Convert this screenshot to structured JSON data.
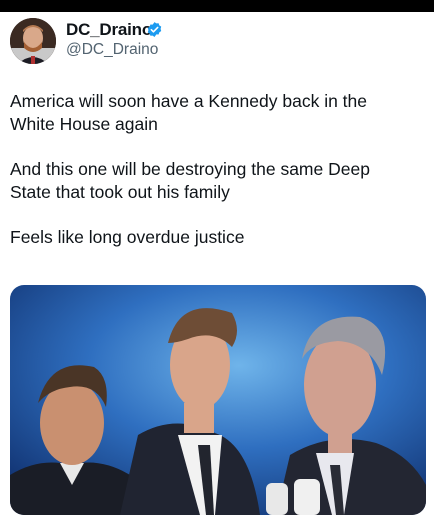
{
  "author": {
    "display_name": "DC_Draino",
    "handle": "@DC_Draino",
    "verified_icon": "verified-badge-icon",
    "verified_color": "#1d9bf0"
  },
  "tweet": {
    "paragraphs": [
      "America will soon have a Kennedy back in the\nWhite House again",
      "And this one will be destroying the same Deep\nState that took out his family",
      "Feels like long overdue justice"
    ]
  },
  "media": {
    "description_icon": "photo-icon",
    "background_colors": [
      "#5aa3e0",
      "#1f4f9a",
      "#0e2a66"
    ]
  }
}
